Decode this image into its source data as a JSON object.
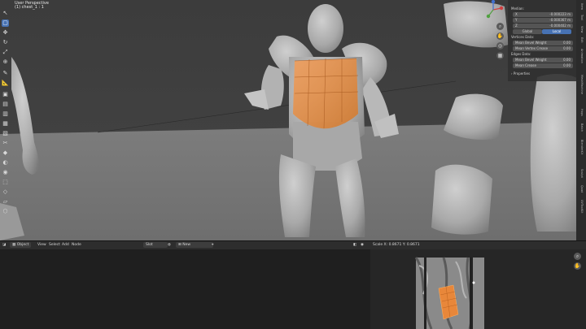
{
  "viewport": {
    "title": "User Perspective",
    "object_label": "(1) chest_1 : 1",
    "toolbar_icons": [
      "cursor-icon",
      "select-box-icon",
      "move-icon",
      "rotate-icon",
      "scale-icon",
      "transform-icon",
      "annotate-icon",
      "measure-icon",
      "add-cube-icon",
      "extrude-icon",
      "inset-icon",
      "bevel-icon",
      "loop-cut-icon",
      "knife-icon",
      "poly-build-icon",
      "spin-icon",
      "smooth-icon",
      "edge-slide-icon",
      "shrink-icon",
      "shear-icon",
      "rip-icon"
    ]
  },
  "n_panel": {
    "section_median": "Median:",
    "x_label": "X",
    "x_value": "-0.000223 m",
    "y_label": "Y",
    "y_value": "-0.000367 m",
    "z_label": "Z",
    "z_value": "-0.000402 m",
    "global_btn": "Global",
    "local_btn": "Local",
    "vertices_title": "Vertices Data:",
    "v_bevel_label": "Mean Bevel Weight",
    "v_bevel_value": "0.00",
    "v_crease_label": "Mean Vertex Crease",
    "v_crease_value": "0.00",
    "edges_title": "Edges Data:",
    "e_bevel_label": "Mean Bevel Weight",
    "e_bevel_value": "0.00",
    "e_crease_label": "Mean Crease",
    "e_crease_value": "0.00",
    "properties_label": "Properties",
    "tabs": [
      "Item",
      "Tool",
      "View",
      "Edit",
      "Animation",
      "MeshMachine",
      "Hops",
      "Batch",
      "BlenderKit",
      "Sculpt",
      "Quad",
      "UVToolKit"
    ]
  },
  "uv_header": {
    "mode": "Object",
    "menus": [
      "View",
      "Select",
      "Add",
      "Node"
    ],
    "slot": "Slot",
    "new_btn": "New"
  },
  "image_header": {
    "scale": "Scale X: 0.8671   Y: 0.8671"
  },
  "accent_color": "#4772b3",
  "selection_color": "#e8873a"
}
